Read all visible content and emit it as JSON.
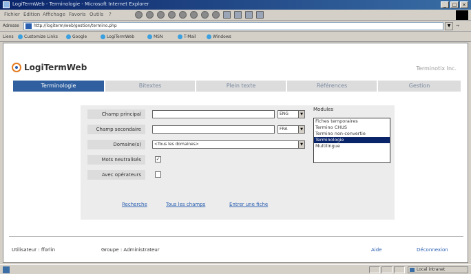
{
  "browser": {
    "title": "LogiTermWeb - Terminologie - Microsoft Internet Explorer",
    "menu": [
      "Fichier",
      "Edition",
      "Affichage",
      "Favoris",
      "Outils",
      "?"
    ],
    "address_label": "Adresse",
    "address": "http://logiterm/web/gestion/termino.php",
    "links_label": "Liens",
    "links": [
      "Customize Links",
      "Google",
      "LogiTermWeb",
      "MSN",
      "T-Mail",
      "Windows"
    ],
    "zone": "Local intranet"
  },
  "app": {
    "logo_text": "LogiTermWeb",
    "company": "Terminotix Inc.",
    "tabs": [
      {
        "label": "Terminologie",
        "active": true
      },
      {
        "label": "Bitextes",
        "active": false
      },
      {
        "label": "Plein texte",
        "active": false
      },
      {
        "label": "Références",
        "active": false
      },
      {
        "label": "Gestion",
        "active": false
      }
    ]
  },
  "form": {
    "primary_label": "Champ principal",
    "primary_value": "",
    "primary_lang": "ENG",
    "secondary_label": "Champ secondaire",
    "secondary_value": "",
    "secondary_lang": "FRA",
    "domain_label": "Domaine(s)",
    "domain_value": "<Tous les domaines>",
    "neutral_label": "Mots neutralisés",
    "neutral_checked": true,
    "operators_label": "Avec opérateurs",
    "operators_checked": false,
    "modules_label": "Modules",
    "modules": [
      {
        "label": "Fiches temporaires",
        "selected": false
      },
      {
        "label": "Termino CHUS",
        "selected": false
      },
      {
        "label": "Termino non-convertie",
        "selected": false
      },
      {
        "label": "Terminologie",
        "selected": true
      },
      {
        "label": "Multilingue",
        "selected": false
      }
    ],
    "links": [
      "Recherche",
      "Tous les champs",
      "Entrer une fiche"
    ]
  },
  "footer": {
    "user": "Utilisateur : fforlin",
    "group": "Groupe : Administrateur",
    "help": "Aide",
    "logout": "Déconnexion"
  },
  "colors": {
    "tab_active": "#2f5f9e",
    "tab_inactive": "#dcdcdc",
    "selection": "#0a246a",
    "link": "#2a5fb0"
  }
}
